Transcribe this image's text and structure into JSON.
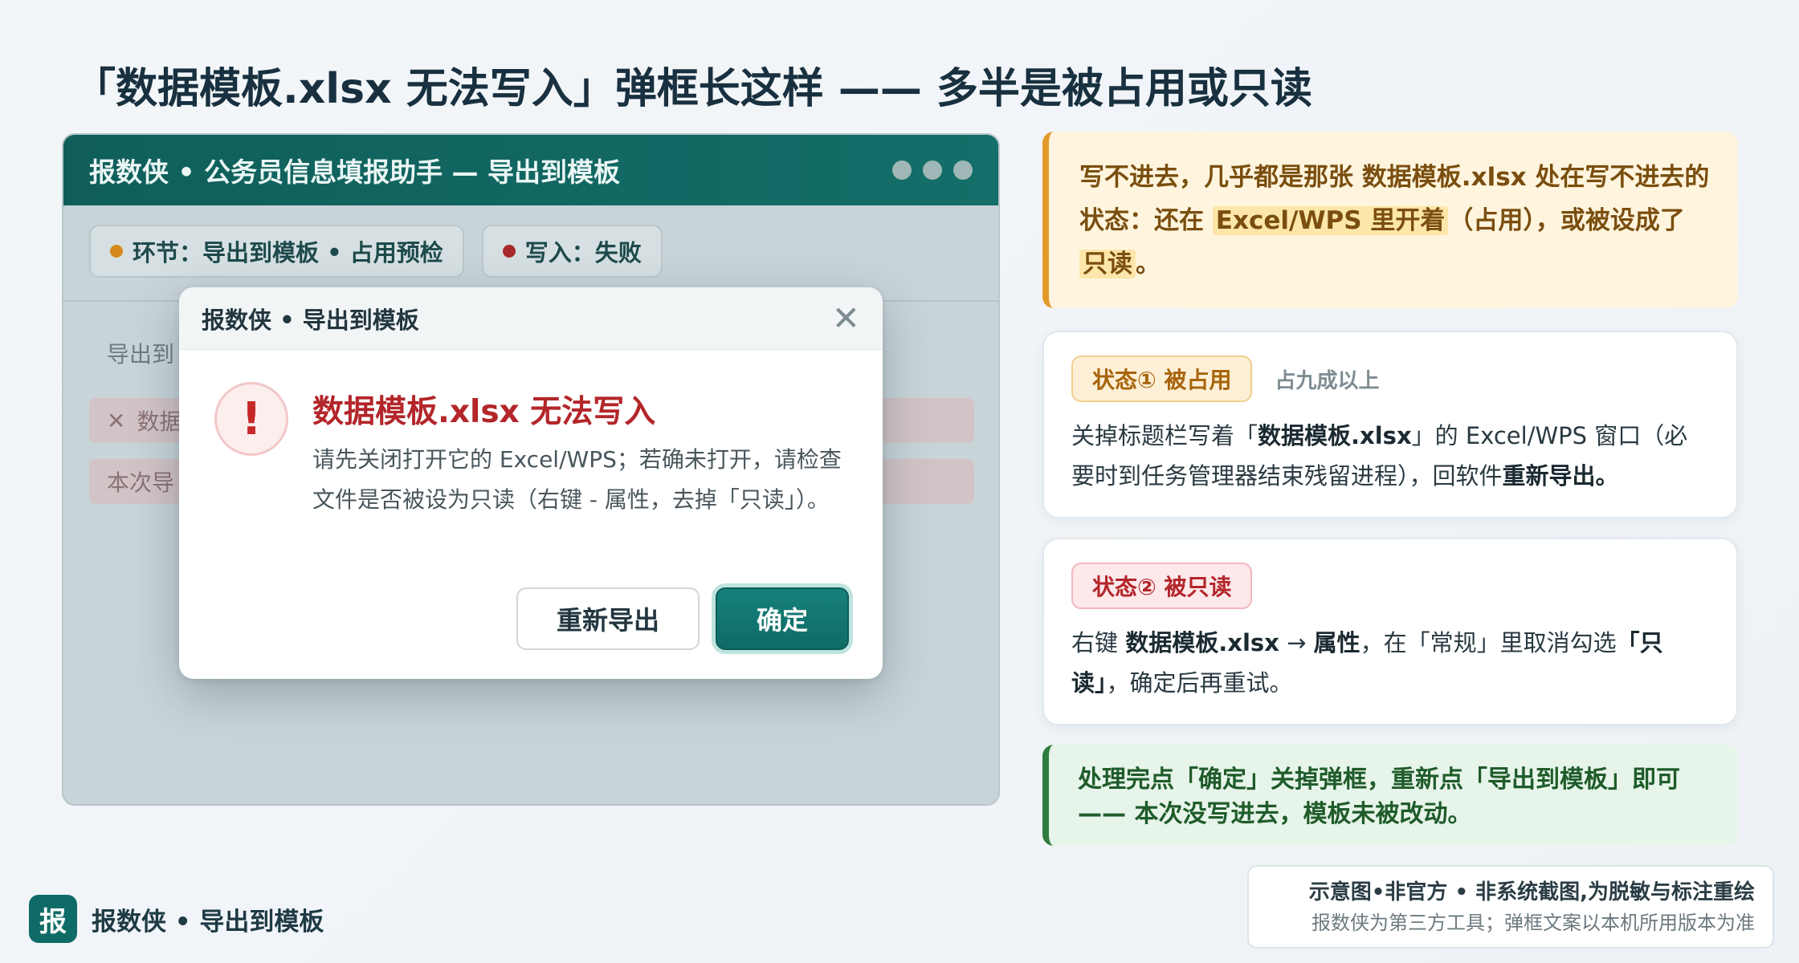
{
  "page_title": "「数据模板.xlsx 无法写入」弹框长这样 —— 多半是被占用或只读",
  "app": {
    "title": "报数侠 • 公务员信息填报助手 — 导出到模板",
    "stage_chip": "环节：导出到模板 • 占用预检",
    "write_chip": "写入：失败",
    "bg_label": "导出到",
    "bg_row1": "数据",
    "bg_row2": "本次导"
  },
  "dialog": {
    "title": "报数侠 • 导出到模板",
    "close": "✕",
    "icon": "!",
    "heading": "数据模板.xlsx 无法写入",
    "message": "请先关闭打开它的 Excel/WPS；若确未打开，请检查文件是否被设为只读（右键 - 属性，去掉「只读」）。",
    "retry_button": "重新导出",
    "ok_button": "确定"
  },
  "callout": {
    "part1": "写不进去，几乎都是那张 数据模板.xlsx 处在写不进去的状态：还在 ",
    "hl1": "Excel/WPS 里开着",
    "part2": "（占用），或被设成了 ",
    "hl2": "只读",
    "part3": "。"
  },
  "card1": {
    "badge": "状态① 被占用",
    "note": "占九成以上",
    "t1": "关掉标题栏写着「",
    "b1": "数据模板.xlsx",
    "t2": "」的 Excel/WPS 窗口（必要时到任务管理器结束残留进程），回软件",
    "b2": "重新导出。"
  },
  "card2": {
    "badge": "状态② 被只读",
    "t1": "右键 ",
    "b1": "数据模板.xlsx",
    "t2": " → ",
    "b2": "属性",
    "t3": "，在「常规」里取消勾选",
    "b3": "「只读」",
    "t4": "，确定后再重试。"
  },
  "success": {
    "line1": "处理完点「确定」关掉弹框，重新点「导出到模板」即可",
    "line2": "—— 本次没写进去，模板未被改动。"
  },
  "footer": {
    "logo": "报",
    "brand": "报数侠 • 导出到模板",
    "disclaimer1": "示意图•非官方 • 非系统截图,为脱敏与标注重绘",
    "disclaimer2": "报数侠为第三方工具；弹框文案以本机所用版本为准"
  },
  "colors": {
    "teal": "#0f6b66",
    "error_red": "#b3262a",
    "stage_dot": "#d4891a",
    "fail_dot": "#a82a2a",
    "success_green": "#2e7d3e",
    "warn_orange": "#e39a2a"
  },
  "icons": {
    "close": "close-icon",
    "error": "exclamation-icon",
    "x_mark": "x-mark-icon"
  }
}
